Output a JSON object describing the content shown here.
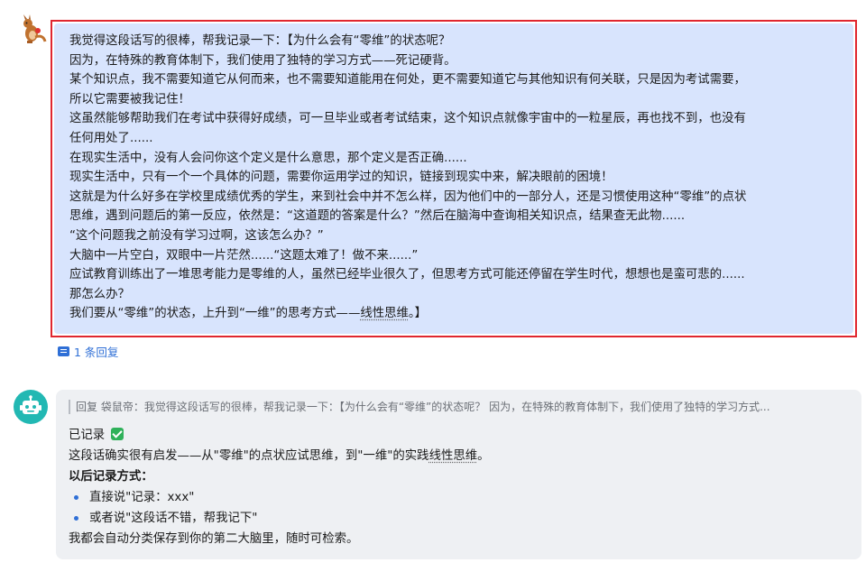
{
  "thread": {
    "user_message": {
      "lines": [
        "我觉得这段话写的很棒，帮我记录一下：【为什么会有“零维”的状态呢？",
        "因为，在特殊的教育体制下，我们使用了独特的学习方式——死记硬背。",
        "某个知识点，我不需要知道它从何而来，也不需要知道能用在何处，更不需要知道它与其他知识有何关联，只是因为考试需要，",
        "所以它需要被我记住！",
        "这虽然能够帮助我们在考试中获得好成绩，可一旦毕业或者考试结束，这个知识点就像宇宙中的一粒星辰，再也找不到，也没有",
        "任何用处了......",
        "在现实生活中，没有人会问你这个定义是什么意思，那个定义是否正确......",
        "现实生活中，只有一个一个具体的问题，需要你运用学过的知识，链接到现实中来，解决眼前的困境！",
        "这就是为什么好多在学校里成绩优秀的学生，来到社会中并不怎么样，因为他们中的一部分人，还是习惯使用这种“零维”的点状",
        "思维，遇到问题后的第一反应，依然是：“这道题的答案是什么？”然后在脑海中查询相关知识点，结果查无此物......",
        "“这个问题我之前没有学习过啊，这该怎么办？”",
        "大脑中一片空白，双眼中一片茫然......“这题太难了！做不来......”",
        "应试教育训练出了一堆思考能力是零维的人，虽然已经毕业很久了，但思考方式可能还停留在学生时代，想想也是蛮可悲的......",
        "那怎么办？"
      ],
      "last_line_prefix": "我们要从“零维”的状态，上升到“一维”的思考方式——",
      "last_line_term": "线性思维",
      "last_line_suffix": "。】"
    },
    "reply_count_label": "1 条回复",
    "bot_message": {
      "quote": "回复 袋鼠帝：我觉得这段话写的很棒，帮我记录一下：【为什么会有“零维”的状态呢？ 因为，在特殊的教育体制下，我们使用了独特的学习方式...",
      "recorded": "已记录",
      "insight_prefix": "这段话确实很有启发——从\"零维\"的点状应试思维，到\"一维\"的实践",
      "insight_term": "线性思维",
      "insight_suffix": "。",
      "method_title": "以后记录方式：",
      "methods": [
        "直接说\"记录：xxx\"",
        "或者说\"这段话不错，帮我记下\""
      ],
      "footer": "我都会自动分类保存到你的第二大脑里，随时可检索。"
    }
  },
  "colors": {
    "highlight_border": "#e0262f",
    "user_bubble": "#d8e4fd",
    "link": "#2f6fd6",
    "bot_avatar": "#22b8b3",
    "bot_bubble": "#eef0f3"
  }
}
